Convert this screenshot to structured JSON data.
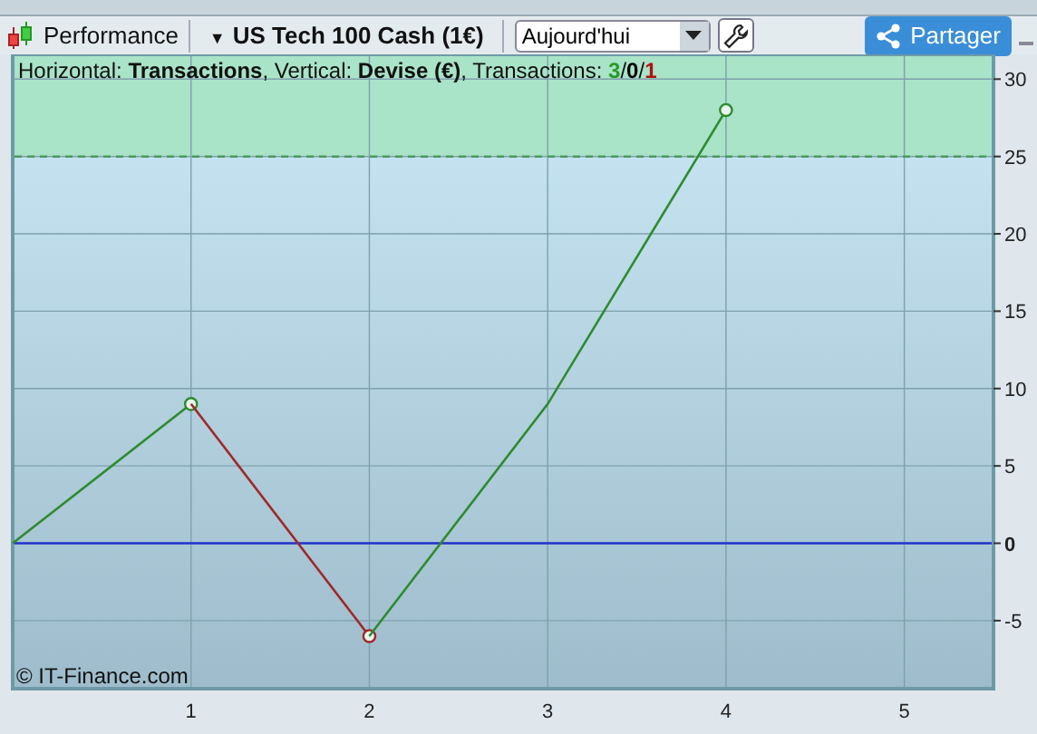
{
  "toolbar": {
    "title": "Performance",
    "instrument_caret": "▼",
    "instrument": "US Tech 100 Cash (1€)",
    "period": {
      "value": "Aujourd'hui"
    },
    "share_button": "Partager"
  },
  "chart": {
    "header": "Horizontal: **Transactions**, Vertical: **Devise (€)**, Transactions: ",
    "counts": [
      {
        "value": "3",
        "color": "#2a9a2a"
      },
      {
        "value": "0",
        "color": "#000000"
      },
      {
        "value": "1",
        "color": "#b01010"
      }
    ],
    "separator": "/",
    "credit": "© IT-Finance.com",
    "chart_data": {
      "type": "line",
      "x": [
        0,
        1,
        2,
        3,
        4
      ],
      "series": [
        {
          "color": "#2e8b2e",
          "values": [
            0,
            9,
            null,
            null,
            null
          ]
        },
        {
          "color": "#a02828",
          "values": [
            null,
            9,
            -6,
            null,
            null
          ]
        },
        {
          "color": "#2e8b2e",
          "values": [
            null,
            null,
            -6,
            9,
            28
          ]
        }
      ],
      "xlim": [
        0,
        5.5
      ],
      "ylim": [
        -9.4,
        31.6
      ],
      "xticks": [
        1,
        2,
        3,
        4,
        5
      ],
      "yticks": [
        -5,
        0,
        5,
        10,
        15,
        20,
        25,
        30
      ],
      "grid": true,
      "bands": [
        {
          "axis": "y",
          "from": 25,
          "to": 31.6,
          "color": "#a9e3c8"
        }
      ],
      "ref_lines": [
        {
          "axis": "y",
          "value": 25,
          "color": "#4a9a5a"
        },
        {
          "axis": "y",
          "value": 0,
          "color": "#2233cc"
        }
      ]
    }
  }
}
